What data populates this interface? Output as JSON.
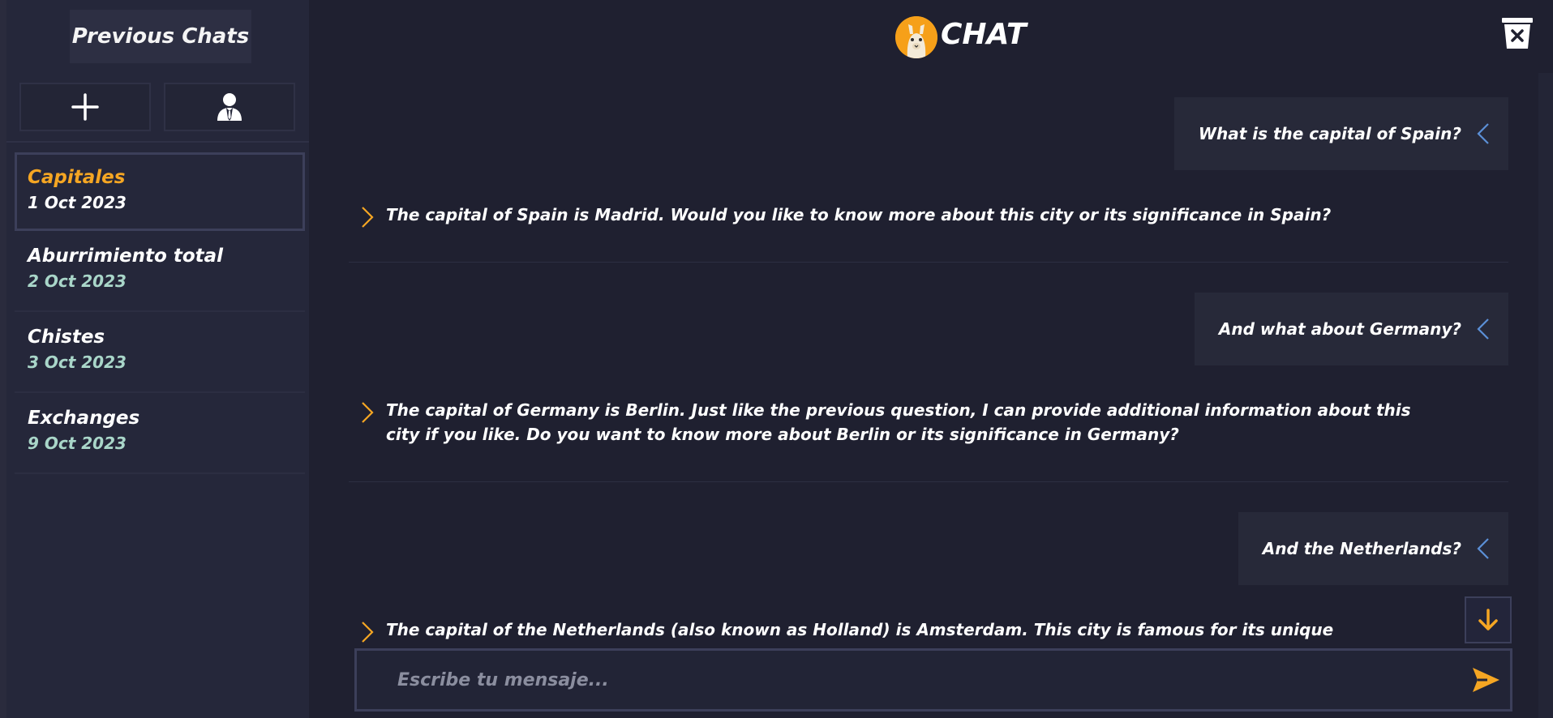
{
  "sidebar": {
    "title": "Previous Chats",
    "chats": [
      {
        "name": "Capitales",
        "date": "1 Oct 2023",
        "active": true
      },
      {
        "name": "Aburrimiento total",
        "date": "2 Oct 2023"
      },
      {
        "name": "Chistes",
        "date": "3 Oct 2023"
      },
      {
        "name": "Exchanges",
        "date": "9 Oct 2023"
      }
    ]
  },
  "header": {
    "title": "CHAT",
    "logo_icon": "llama-icon"
  },
  "conversation": [
    {
      "role": "user",
      "text": "What is the capital of Spain?"
    },
    {
      "role": "bot",
      "text": "The capital of Spain is Madrid. Would you like to know more about this city or its significance in Spain?"
    },
    {
      "role": "user",
      "text": "And what about Germany?"
    },
    {
      "role": "bot",
      "text": "The capital of Germany is Berlin. Just like the previous question, I can provide additional information about this city if you like. Do you want to know more about Berlin or its significance in Germany?"
    },
    {
      "role": "user",
      "text": "And the Netherlands?"
    },
    {
      "role": "bot",
      "text": "The capital of the Netherlands (also known as Holland) is Amsterdam. This city is famous for its unique architecture, canals, and vibrant cultural scene. If you would like, I can tell you more about Amsterdam and its role as the capital of the Netherlands."
    }
  ],
  "input": {
    "placeholder": "Escribe tu mensaje...",
    "value": ""
  },
  "colors": {
    "accent": "#f5a623",
    "user_chevron": "#5b8fd6",
    "date": "#a9d6c9",
    "background": "#1f2030",
    "sidebar": "#25273a"
  }
}
